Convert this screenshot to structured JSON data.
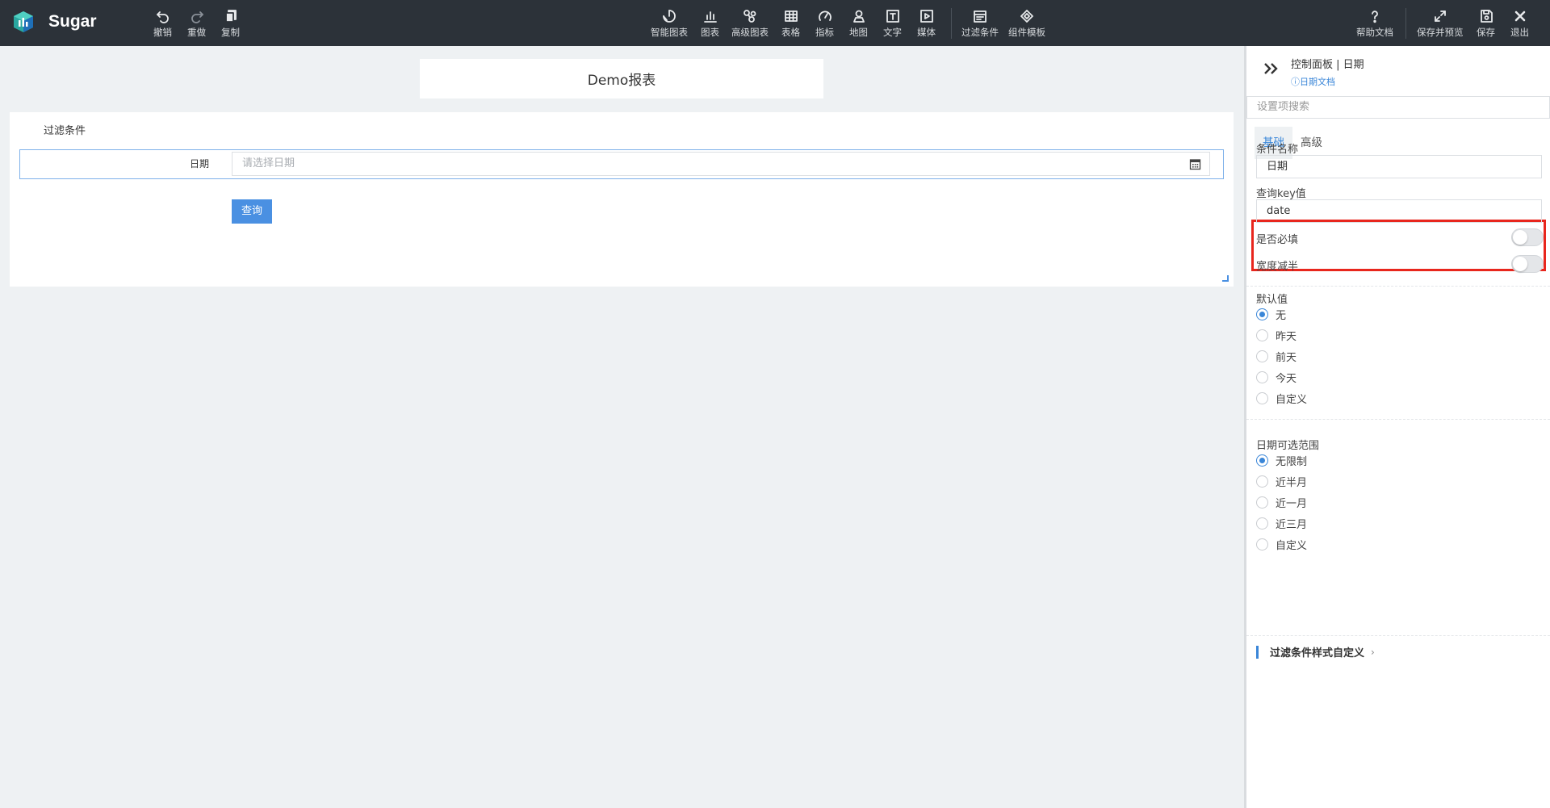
{
  "app": {
    "name": "Sugar"
  },
  "toolbar": {
    "left": [
      {
        "id": "undo",
        "label": "撤销",
        "icon": "undo-icon"
      },
      {
        "id": "redo",
        "label": "重做",
        "icon": "redo-icon"
      },
      {
        "id": "copy",
        "label": "复制",
        "icon": "copy-icon"
      }
    ],
    "center": [
      {
        "id": "smart-chart",
        "label": "智能图表",
        "icon": "smart-chart-icon"
      },
      {
        "id": "chart",
        "label": "图表",
        "icon": "bar-chart-icon"
      },
      {
        "id": "advanced-chart",
        "label": "高级图表",
        "icon": "advanced-chart-icon"
      },
      {
        "id": "table",
        "label": "表格",
        "icon": "table-icon"
      },
      {
        "id": "metric",
        "label": "指标",
        "icon": "gauge-icon"
      },
      {
        "id": "map",
        "label": "地图",
        "icon": "map-pin-icon"
      },
      {
        "id": "text",
        "label": "文字",
        "icon": "text-icon"
      },
      {
        "id": "media",
        "label": "媒体",
        "icon": "media-play-icon"
      },
      {
        "id": "filter",
        "label": "过滤条件",
        "icon": "filter-calendar-icon"
      },
      {
        "id": "component-template",
        "label": "组件模板",
        "icon": "template-icon"
      }
    ],
    "right": [
      {
        "id": "help",
        "label": "帮助文档",
        "icon": "help-icon"
      },
      {
        "id": "save-preview",
        "label": "保存并预览",
        "icon": "expand-icon"
      },
      {
        "id": "save",
        "label": "保存",
        "icon": "save-icon"
      },
      {
        "id": "exit",
        "label": "退出",
        "icon": "close-icon"
      }
    ]
  },
  "report": {
    "title": "Demo报表",
    "filter_card": {
      "heading": "过滤条件",
      "date_label": "日期",
      "date_placeholder": "请选择日期",
      "query_button": "查询"
    }
  },
  "panel": {
    "title": "控制面板 | 日期",
    "doc_link": "ⓘ日期文档",
    "search_placeholder": "设置项搜索",
    "tabs": [
      {
        "label": "基础",
        "active": true
      },
      {
        "label": "高级",
        "active": false
      }
    ],
    "condition_name": {
      "label": "条件名称",
      "value": "日期"
    },
    "query_key": {
      "label": "查询key值",
      "value": "date"
    },
    "required": {
      "label": "是否必填",
      "on": false
    },
    "half_width": {
      "label": "宽度减半",
      "on": false
    },
    "default_value": {
      "label": "默认值",
      "options": [
        "无",
        "昨天",
        "前天",
        "今天",
        "自定义"
      ],
      "selected": "无"
    },
    "date_range": {
      "label": "日期可选范围",
      "options": [
        "无限制",
        "近半月",
        "近一月",
        "近三月",
        "自定义"
      ],
      "selected": "无限制"
    },
    "custom_style": {
      "label": "过滤条件样式自定义",
      "chevron": "›"
    }
  },
  "colors": {
    "topbar": "#2c3239",
    "accent": "#3a86d8",
    "button": "#4a90e2",
    "highlight": "#e8261d",
    "canvas": "#eef1f3"
  }
}
